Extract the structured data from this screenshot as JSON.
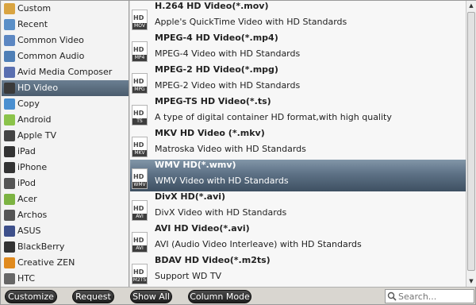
{
  "categories": [
    {
      "label": "Custom",
      "icon": "custom-folder-icon",
      "color": "#d9a441"
    },
    {
      "label": "Recent",
      "icon": "recent-clock-icon",
      "color": "#5a8fc7"
    },
    {
      "label": "Common Video",
      "icon": "film-icon",
      "color": "#5c87c2"
    },
    {
      "label": "Common Audio",
      "icon": "music-note-icon",
      "color": "#4f7fb6"
    },
    {
      "label": "Avid Media Composer",
      "icon": "avid-icon",
      "color": "#5a6fb0"
    },
    {
      "label": "HD Video",
      "icon": "hd-icon",
      "color": "#3a3a3a",
      "selected": true
    },
    {
      "label": "Copy",
      "icon": "copy-icon",
      "color": "#4a8fd0"
    },
    {
      "label": "Android",
      "icon": "android-icon",
      "color": "#8bc34a"
    },
    {
      "label": "Apple TV",
      "icon": "apple-tv-icon",
      "color": "#444444"
    },
    {
      "label": "iPad",
      "icon": "ipad-icon",
      "color": "#333333"
    },
    {
      "label": "iPhone",
      "icon": "iphone-icon",
      "color": "#333333"
    },
    {
      "label": "iPod",
      "icon": "ipod-icon",
      "color": "#555555"
    },
    {
      "label": "Acer",
      "icon": "acer-icon",
      "color": "#7cb342"
    },
    {
      "label": "Archos",
      "icon": "archos-icon",
      "color": "#555555"
    },
    {
      "label": "ASUS",
      "icon": "asus-icon",
      "color": "#3d4f8a"
    },
    {
      "label": "BlackBerry",
      "icon": "blackberry-icon",
      "color": "#333333"
    },
    {
      "label": "Creative ZEN",
      "icon": "creative-zen-icon",
      "color": "#e08a1e"
    },
    {
      "label": "HTC",
      "icon": "htc-icon",
      "color": "#666666"
    }
  ],
  "formats": [
    {
      "title": "H.264 HD Video(*.mov)",
      "desc": "Apple's QuickTime Video with HD Standards",
      "tag": "MOV"
    },
    {
      "title": "MPEG-4 HD Video(*.mp4)",
      "desc": "MPEG-4 Video with HD Standards",
      "tag": "MP4"
    },
    {
      "title": "MPEG-2 HD Video(*.mpg)",
      "desc": "MPEG-2 Video with HD Standards",
      "tag": "MPG"
    },
    {
      "title": "MPEG-TS HD Video(*.ts)",
      "desc": "A type of digital container HD format,with high quality",
      "tag": "TS"
    },
    {
      "title": "MKV HD Video (*.mkv)",
      "desc": "Matroska Video with HD Standards",
      "tag": "MKV"
    },
    {
      "title": "WMV HD(*.wmv)",
      "desc": "WMV Video with HD Standards",
      "tag": "WMV",
      "selected": true
    },
    {
      "title": "DivX HD(*.avi)",
      "desc": "DivX Video with HD Standards",
      "tag": "AVI"
    },
    {
      "title": "AVI HD Video(*.avi)",
      "desc": "AVI (Audio Video Interleave) with HD Standards",
      "tag": "AVI"
    },
    {
      "title": "BDAV HD Video(*.m2ts)",
      "desc": "Support WD TV",
      "tag": "M2TS"
    }
  ],
  "format_icon_hd": "HD",
  "toolbar": {
    "customize": "Customize",
    "request": "Request",
    "show_all": "Show All",
    "column_mode": "Column Mode"
  },
  "search": {
    "placeholder": "Search...",
    "value": ""
  },
  "colors": {
    "selection": "#4b5c6d",
    "button_bg": "#2a2a2a"
  }
}
